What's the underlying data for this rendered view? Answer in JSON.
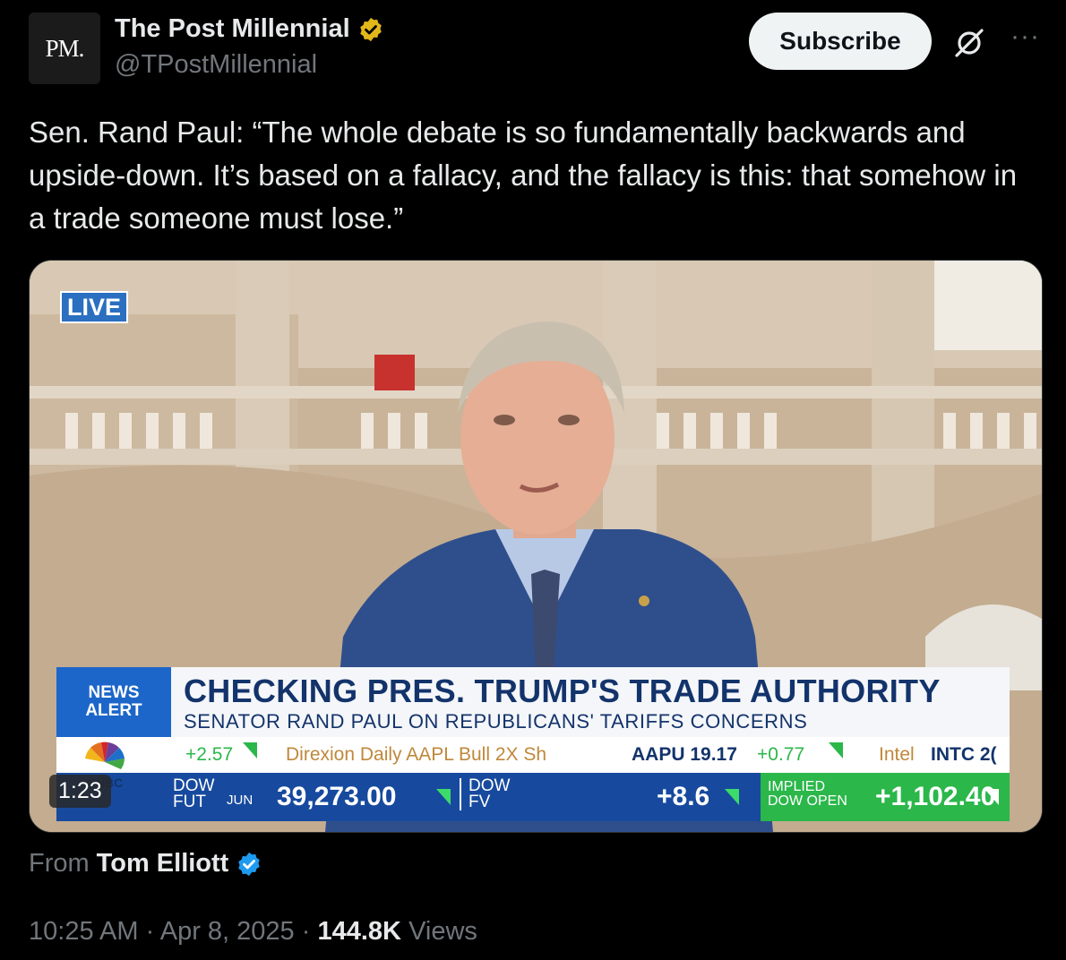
{
  "author": {
    "avatar_text": "PM.",
    "name": "The Post Millennial",
    "handle": "@TPostMillennial",
    "badge": "gold-verified-icon"
  },
  "actions": {
    "subscribe_label": "Subscribe",
    "grok_icon": "grok-icon",
    "more_label": "···"
  },
  "tweet": {
    "text": "Sen. Rand Paul: “The whole debate is so fundamentally backwards and upside-down. It’s based on a fallacy, and the fallacy is this: that somehow in a trade someone must lose.”"
  },
  "video": {
    "live_label": "LIVE",
    "duration": "1:23",
    "news_alert_line1": "NEWS",
    "news_alert_line2": "ALERT",
    "headline": "CHECKING PRES. TRUMP'S TRADE AUTHORITY",
    "subheadline": "SENATOR RAND PAUL ON REPUBLICANS' TARIFFS CONCERNS",
    "ticker_top": {
      "item1": "+2.57",
      "item2_name": "Direxion Daily AAPL Bull 2X Sh",
      "item2_symbol": "AAPU 19.17",
      "item2_change": "+0.77",
      "item3_name": "Intel",
      "item3_symbol": "INTC 2("
    },
    "ticker_bottom": {
      "dow_fut_label1": "DOW",
      "dow_fut_label2": "FUT",
      "dow_fut_month": "JUN",
      "dow_fut_value": "39,273.00",
      "dow_fv_label1": "DOW",
      "dow_fv_label2": "FV",
      "dow_fv_value": "+8.6",
      "implied_label1": "IMPLIED",
      "implied_label2": "DOW OPEN",
      "implied_value": "+1,102.40"
    },
    "network_logo": "cnbc-peacock-icon",
    "network_text": "CNBC"
  },
  "source": {
    "from_label": "From",
    "from_name": "Tom Elliott",
    "badge": "blue-verified-icon"
  },
  "meta": {
    "time": "10:25 AM",
    "separator": "·",
    "date": "Apr 8, 2025",
    "views_count": "144.8K",
    "views_label": "Views"
  },
  "colors": {
    "background": "#000000",
    "text": "#e7e9ea",
    "muted": "#71767b",
    "gold_badge": "#e2b719",
    "blue_badge": "#1d9bf0",
    "cnbc_blue": "#174a9e",
    "cnbc_headline": "#13336b",
    "ticker_green": "#2bb74a"
  }
}
